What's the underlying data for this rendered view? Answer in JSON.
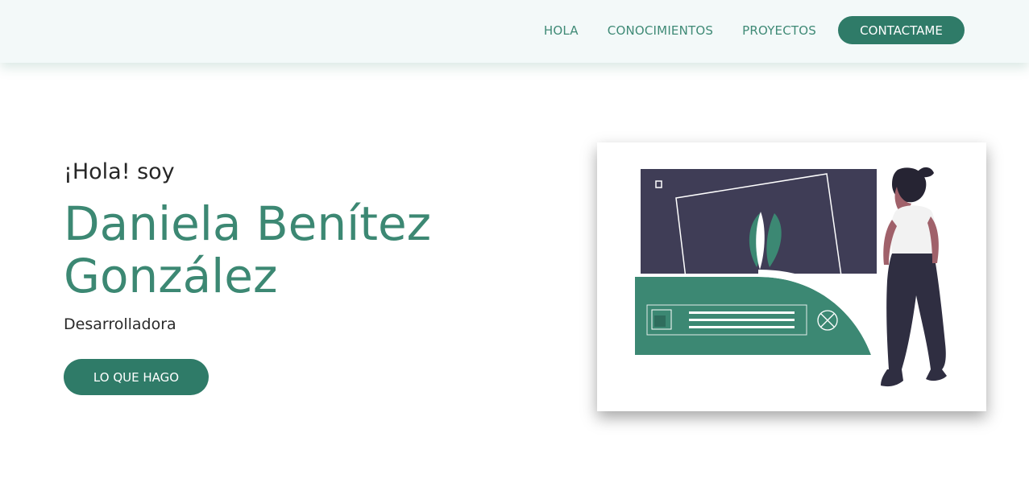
{
  "nav": {
    "items": [
      {
        "label": "HOLA"
      },
      {
        "label": "CONOCIMIENTOS"
      },
      {
        "label": "PROYECTOS"
      }
    ],
    "cta_label": "CONTACTAME"
  },
  "hero": {
    "greeting": "¡Hola! soy",
    "name": "Daniela Benítez González",
    "role": "Desarrolladora",
    "cta_label": "LO QUE HAGO"
  },
  "colors": {
    "accent": "#2f7b68",
    "heading": "#3c8873",
    "navbar_bg": "#f3f9f9",
    "illustration_dark": "#3f3d56"
  }
}
